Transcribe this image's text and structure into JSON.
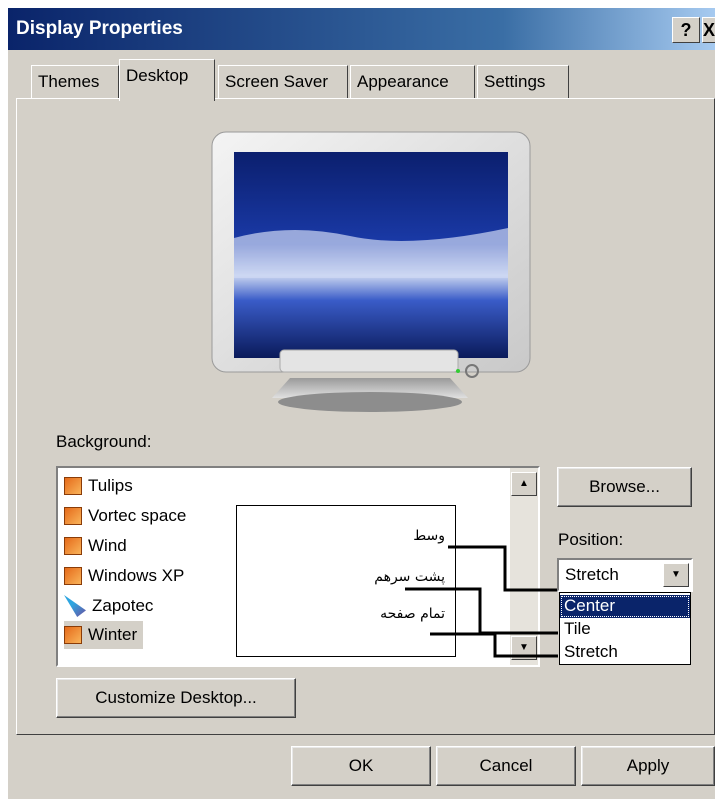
{
  "window": {
    "title": "Display Properties",
    "help_label": "?",
    "close_label": "X"
  },
  "tabs": [
    {
      "label": "Themes",
      "active": false
    },
    {
      "label": "Desktop",
      "active": true
    },
    {
      "label": "Screen Saver",
      "active": false
    },
    {
      "label": "Appearance",
      "active": false
    },
    {
      "label": "Settings",
      "active": false
    }
  ],
  "background": {
    "label": "Background:",
    "items": [
      {
        "label": "Tulips",
        "icon": "image-file-icon"
      },
      {
        "label": "Vortec space",
        "icon": "image-file-icon"
      },
      {
        "label": "Wind",
        "icon": "image-file-icon"
      },
      {
        "label": "Windows XP",
        "icon": "image-file-icon"
      },
      {
        "label": "Zapotec",
        "icon": "brush-file-icon"
      },
      {
        "label": "Winter",
        "icon": "image-file-icon",
        "selected": true
      }
    ]
  },
  "annotation": {
    "center_fa": "وسط",
    "tile_fa": "پشت سرهم",
    "stretch_fa": "تمام صفحه"
  },
  "buttons": {
    "browse": "Browse...",
    "customize": "Customize Desktop...",
    "ok": "OK",
    "cancel": "Cancel",
    "apply": "Apply"
  },
  "position": {
    "label": "Position:",
    "value": "Stretch",
    "options": [
      "Center",
      "Tile",
      "Stretch"
    ],
    "highlighted": "Center"
  },
  "colors": {
    "titlebar": "#0a246a",
    "dialog_face": "#d4d0c8",
    "selection": "#0a246a"
  }
}
